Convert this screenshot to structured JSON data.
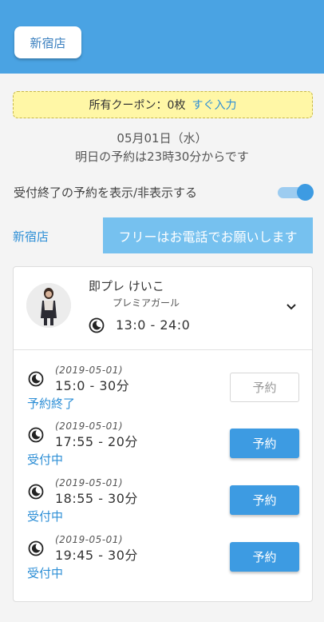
{
  "header": {
    "store_button": "新宿店"
  },
  "coupon": {
    "text": "所有クーポン：0枚",
    "link": "すぐ入力"
  },
  "schedule": {
    "date": "05月01日（水）",
    "notice": "明日の予約は23時30分からです"
  },
  "toggle": {
    "label": "受付終了の予約を表示/非表示する",
    "on": true
  },
  "shop_link": "新宿店",
  "free_button": "フリーはお電話でお願いします",
  "girl": {
    "name": "即プレ けいこ",
    "rank": "プレミアガール",
    "shift": "13:0 - 24:0",
    "icon": "moon-clock-icon",
    "expand_icon": "chevron-down-icon"
  },
  "slots": [
    {
      "date": "(2019-05-01)",
      "time": "15:0 - 30分",
      "status": "予約終了",
      "button": "予約",
      "available": false
    },
    {
      "date": "(2019-05-01)",
      "time": "17:55 - 20分",
      "status": "受付中",
      "button": "予約",
      "available": true
    },
    {
      "date": "(2019-05-01)",
      "time": "18:55 - 30分",
      "status": "受付中",
      "button": "予約",
      "available": true
    },
    {
      "date": "(2019-05-01)",
      "time": "19:45 - 30分",
      "status": "受付中",
      "button": "予約",
      "available": true
    }
  ],
  "colors": {
    "primary": "#4aa3e3",
    "button": "#3d9be2",
    "coupon_bg": "#fff7a6",
    "link": "#2e8fd6"
  }
}
